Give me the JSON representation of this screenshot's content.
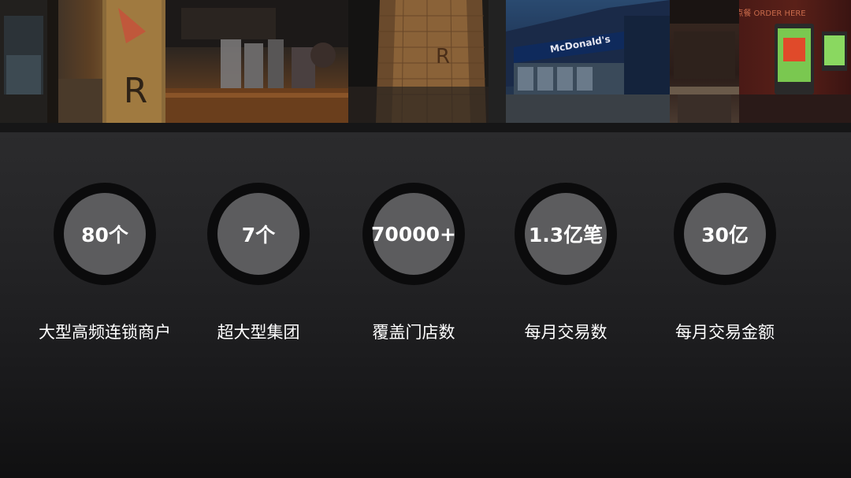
{
  "banner": {
    "photos": [
      {
        "name": "coffee-roastery-interior",
        "color": "#3a2a1c"
      },
      {
        "name": "coffee-bar-counter",
        "color": "#4a3220"
      },
      {
        "name": "copper-cask-tower",
        "color": "#5a3e24"
      },
      {
        "name": "mcdonalds-storefront",
        "color": "#1c2c44"
      },
      {
        "name": "dining-area",
        "color": "#2a1e1a"
      },
      {
        "name": "order-kiosk",
        "color": "#3a1614"
      }
    ],
    "storefront_sign": "McDonald's",
    "kiosk_sign": "点餐 ORDER HERE"
  },
  "stats": [
    {
      "value": "80个",
      "label": "大型高频连锁商户"
    },
    {
      "value": "7个",
      "label": "超大型集团"
    },
    {
      "value": "70000+",
      "label": "覆盖门店数"
    },
    {
      "value": "1.3亿笔",
      "label": "每月交易数"
    },
    {
      "value": "30亿",
      "label": "每月交易金额"
    }
  ]
}
